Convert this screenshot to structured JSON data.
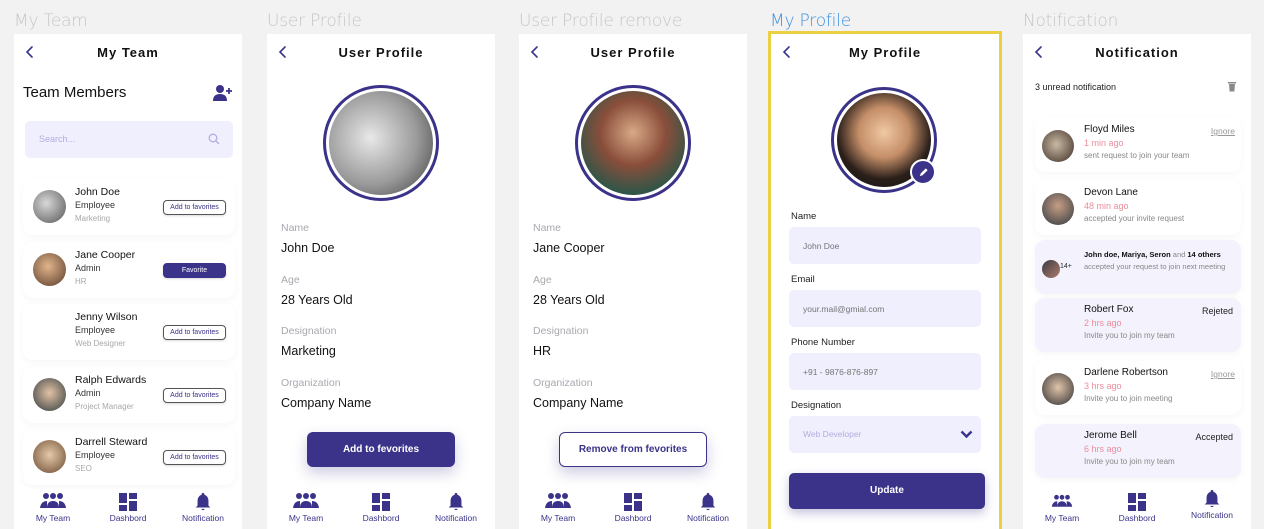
{
  "frames": [
    {
      "label": "My Team"
    },
    {
      "label": "User Profile"
    },
    {
      "label": "User Profile remove"
    },
    {
      "label": "My Profile"
    },
    {
      "label": "Notification"
    }
  ],
  "nav": {
    "items": [
      {
        "label": "My Team",
        "icon": "team-icon"
      },
      {
        "label": "Dashbord",
        "icon": "dashboard-icon"
      },
      {
        "label": "Notification",
        "icon": "bell-icon"
      }
    ]
  },
  "colors": {
    "primary": "#3a3389",
    "input_bg": "#efeffd",
    "time": "#ec8d9c",
    "selection": "#ecd043",
    "active_label": "#3b8fe0"
  },
  "my_team": {
    "title": "My Team",
    "section_title": "Team Members",
    "search_placeholder": "Search...",
    "members": [
      {
        "name": "John Doe",
        "role": "Employee",
        "dept": "Marketing",
        "button": "Add to favorites",
        "favorite": false
      },
      {
        "name": "Jane Cooper",
        "role": "Admin",
        "dept": "HR",
        "button": "Favorite",
        "favorite": true
      },
      {
        "name": "Jenny Wilson",
        "role": "Employee",
        "dept": "Web Designer",
        "button": "Add to favorites",
        "favorite": false
      },
      {
        "name": "Ralph Edwards",
        "role": "Admin",
        "dept": "Project Manager",
        "button": "Add to favorites",
        "favorite": false
      },
      {
        "name": "Darrell Steward",
        "role": "Employee",
        "dept": "SEO",
        "button": "Add to favorites",
        "favorite": false
      }
    ]
  },
  "user_profile": {
    "title": "User Profile",
    "fields": [
      {
        "label": "Name",
        "value": "John Doe"
      },
      {
        "label": "Age",
        "value": "28 Years Old"
      },
      {
        "label": "Designation",
        "value": "Marketing"
      },
      {
        "label": "Organization",
        "value": "Company Name"
      }
    ],
    "button": "Add to fevorites"
  },
  "user_profile_remove": {
    "title": "User Profile",
    "fields": [
      {
        "label": "Name",
        "value": "Jane Cooper"
      },
      {
        "label": "Age",
        "value": "28 Years Old"
      },
      {
        "label": "Designation",
        "value": "HR"
      },
      {
        "label": "Organization",
        "value": "Company Name"
      }
    ],
    "button": "Remove from fevorites"
  },
  "my_profile": {
    "title": "My Profile",
    "name_label": "Name",
    "name_placeholder": "John Doe",
    "email_label": "Email",
    "email_placeholder": "your.mail@gmial.com",
    "phone_label": "Phone Number",
    "phone_placeholder": "+91 - 9876-876-897",
    "designation_label": "Designation",
    "designation_value": "Web Developer",
    "button": "Update"
  },
  "notification": {
    "title": "Notification",
    "unread": "3 unread notification",
    "items": [
      {
        "name": "Floyd Miles",
        "time": "1 min ago",
        "desc": "sent request to join your team",
        "action": "Ignore"
      },
      {
        "name": "Devon Lane",
        "time": "48 min ago",
        "desc": "accepted your invite request"
      },
      {
        "group_names": "John doe, Mariya, Seron",
        "group_and": "and",
        "group_others": "14 others",
        "group_count": "14+",
        "desc": "accepted your request to join next meeting"
      },
      {
        "name": "Robert Fox",
        "time": "2 hrs ago",
        "desc": "Invite you to join my team",
        "status": "Rejeted"
      },
      {
        "name": "Darlene Robertson",
        "time": "3 hrs ago",
        "desc": "Invite you to join meeting",
        "action": "Ignore"
      },
      {
        "name": "Jerome Bell",
        "time": "6 hrs ago",
        "desc": "Invite you to join my team",
        "status": "Accepted"
      }
    ]
  }
}
